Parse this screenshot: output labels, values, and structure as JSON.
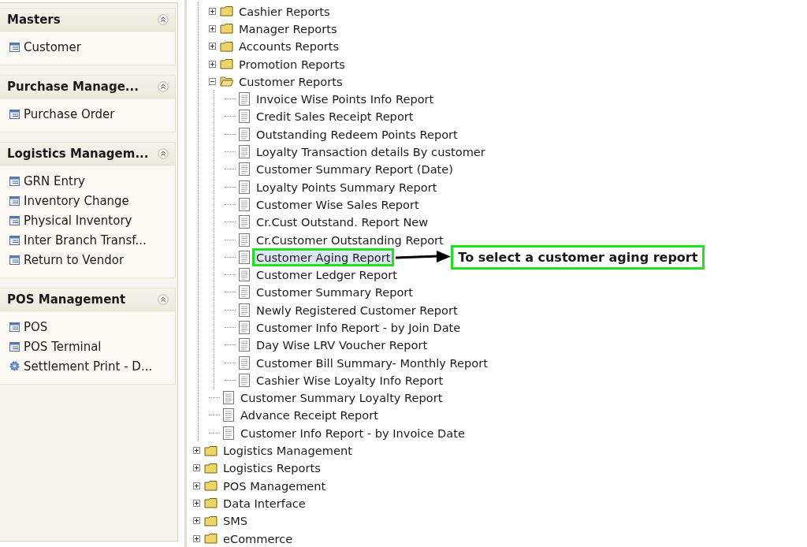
{
  "sidebar": {
    "panels": [
      {
        "title": "Masters",
        "items": [
          {
            "label": "Customer",
            "kind": "form"
          }
        ]
      },
      {
        "title": "Purchase Manage...",
        "items": [
          {
            "label": "Purchase Order",
            "kind": "form"
          }
        ]
      },
      {
        "title": "Logistics Managem...",
        "items": [
          {
            "label": "GRN Entry",
            "kind": "form"
          },
          {
            "label": "Inventory Change",
            "kind": "form"
          },
          {
            "label": "Physical Inventory",
            "kind": "form"
          },
          {
            "label": "Inter Branch Transf...",
            "kind": "form"
          },
          {
            "label": "Return to Vendor",
            "kind": "form"
          }
        ]
      },
      {
        "title": "POS Management",
        "items": [
          {
            "label": "POS",
            "kind": "form"
          },
          {
            "label": "POS Terminal",
            "kind": "form"
          },
          {
            "label": "Settlement Print - D...",
            "kind": "gear"
          }
        ]
      }
    ]
  },
  "tree": {
    "continued_branch": [
      {
        "label": "Cashier Reports",
        "kind": "folder",
        "expanded": false,
        "selected": false
      },
      {
        "label": "Manager Reports",
        "kind": "folder",
        "expanded": false,
        "selected": false
      },
      {
        "label": "Accounts Reports",
        "kind": "folder",
        "expanded": false,
        "selected": false
      },
      {
        "label": "Promotion Reports",
        "kind": "folder",
        "expanded": false,
        "selected": false
      },
      {
        "label": "Customer Reports",
        "kind": "folder",
        "expanded": true,
        "selected": false,
        "children": [
          {
            "label": "Invoice Wise Points Info Report",
            "kind": "report",
            "selected": false
          },
          {
            "label": "Credit Sales Receipt Report",
            "kind": "report",
            "selected": false
          },
          {
            "label": "Outstanding Redeem Points Report",
            "kind": "report",
            "selected": false
          },
          {
            "label": "Loyalty Transaction details By customer",
            "kind": "report",
            "selected": false
          },
          {
            "label": "Customer Summary Report (Date)",
            "kind": "report",
            "selected": false
          },
          {
            "label": "Loyalty Points Summary Report",
            "kind": "report",
            "selected": false
          },
          {
            "label": "Customer Wise Sales Report",
            "kind": "report",
            "selected": false
          },
          {
            "label": "Cr.Cust Outstand. Report New",
            "kind": "report",
            "selected": false
          },
          {
            "label": "Cr.Customer Outstanding Report",
            "kind": "report",
            "selected": false
          },
          {
            "label": "Customer Aging Report",
            "kind": "report",
            "selected": true
          },
          {
            "label": "Customer Ledger Report",
            "kind": "report",
            "selected": false
          },
          {
            "label": "Customer Summary Report",
            "kind": "report",
            "selected": false
          },
          {
            "label": "Newly Registered Customer Report",
            "kind": "report",
            "selected": false
          },
          {
            "label": "Customer Info Report - by Join Date",
            "kind": "report",
            "selected": false
          },
          {
            "label": "Day Wise LRV Voucher Report",
            "kind": "report",
            "selected": false
          },
          {
            "label": "Customer Bill Summary- Monthly Report",
            "kind": "report",
            "selected": false
          },
          {
            "label": "Cashier Wise Loyalty Info Report",
            "kind": "report",
            "selected": false
          }
        ]
      },
      {
        "label": "Customer Summary Loyalty Report",
        "kind": "report",
        "selected": false
      },
      {
        "label": "Advance Receipt Report",
        "kind": "report",
        "selected": false
      },
      {
        "label": "Customer Info Report - by Invoice Date",
        "kind": "report",
        "selected": false
      }
    ],
    "items": [
      {
        "label": "Logistics Management",
        "kind": "folder",
        "expanded": false,
        "selected": false
      },
      {
        "label": "Logistics Reports",
        "kind": "folder",
        "expanded": false,
        "selected": false
      },
      {
        "label": "POS Management",
        "kind": "folder",
        "expanded": false,
        "selected": false
      },
      {
        "label": "Data Interface",
        "kind": "folder",
        "expanded": false,
        "selected": false
      },
      {
        "label": "SMS",
        "kind": "folder",
        "expanded": false,
        "selected": false
      },
      {
        "label": "eCommerce",
        "kind": "folder",
        "expanded": false,
        "selected": false
      }
    ]
  },
  "callout": {
    "text": "To select a customer aging report"
  }
}
